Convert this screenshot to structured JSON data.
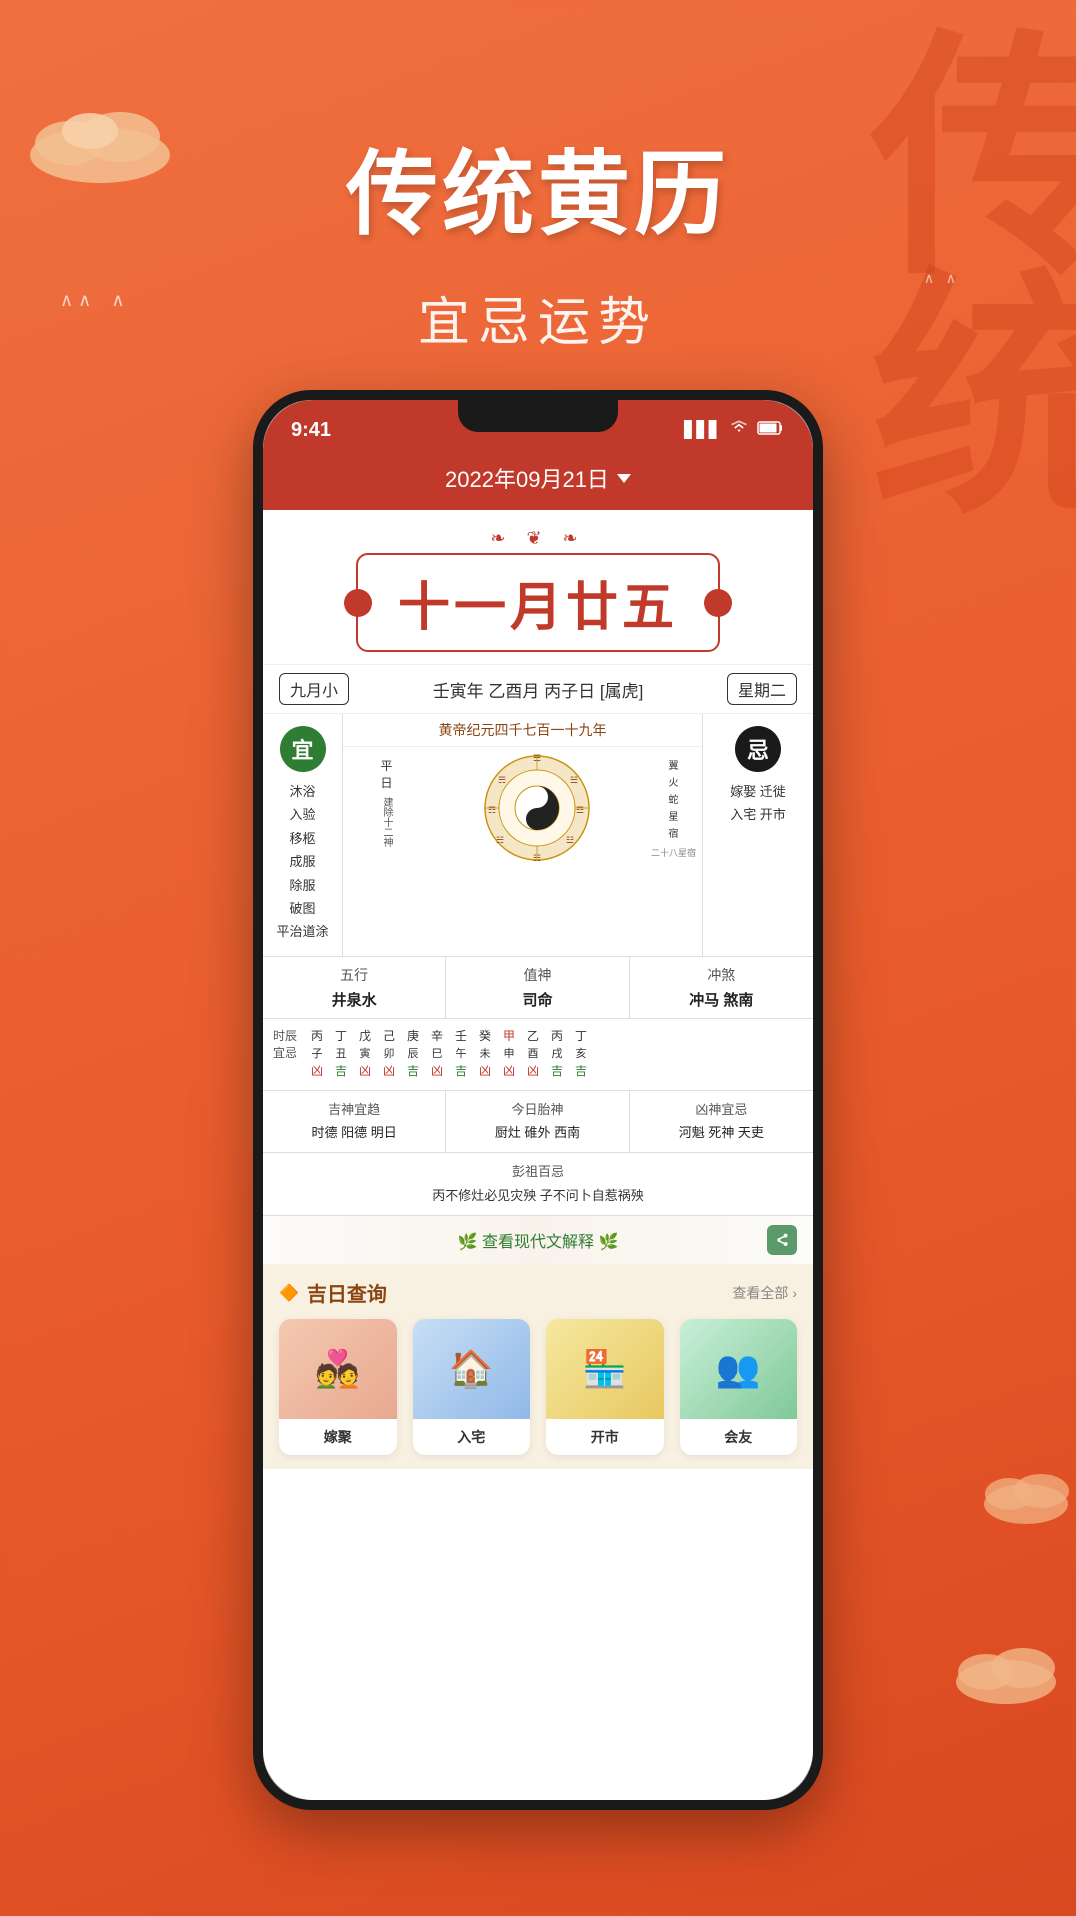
{
  "background": {
    "color": "#e85a30"
  },
  "decorative": {
    "bg_text": "传统",
    "birds": "∨  ∨",
    "birds2": "∨"
  },
  "header": {
    "main_title": "传统黄历",
    "sub_title": "宜忌运势"
  },
  "phone": {
    "status_bar": {
      "time": "9:41",
      "signal": "▋▋▋",
      "wifi": "WiFi",
      "battery": "🔋"
    },
    "date_selector": {
      "label": "2022年09月21日",
      "chevron": "▾"
    },
    "calendar": {
      "deco_top": "❦ ❧",
      "lunar_date": "十一月廿五",
      "month_badge": "九月小",
      "ganzhi": "壬寅年 乙酉月 丙子日 [属虎]",
      "weekday": "星期二",
      "huangdi_year": "黄帝纪元四千七百一十九年",
      "yi_label": "宜",
      "yi_items": [
        "沐浴",
        "入验",
        "移柩",
        "成服",
        "除服",
        "破图",
        "平治道涂"
      ],
      "ji_label": "忌",
      "ji_items": [
        "嫁娶",
        "迁徙",
        "入宅",
        "开市"
      ],
      "jianshen": "建除十二神",
      "pingri": "平日",
      "star1": "翼火蛇星宿",
      "star2": "二十八星宿",
      "five_elements": {
        "label": "五行",
        "value": "井泉水"
      },
      "zhishen": {
        "label": "值神",
        "value": "司命"
      },
      "chong_sha": {
        "label": "冲煞",
        "value": "冲马 煞南"
      },
      "time_stems_label": [
        "时辰",
        "宜忌"
      ],
      "time_stems": [
        {
          "char": "丙",
          "sub": "子",
          "fate": "凶"
        },
        {
          "char": "丁",
          "sub": "丑",
          "fate": "吉"
        },
        {
          "char": "戊",
          "sub": "寅",
          "fate": "凶"
        },
        {
          "char": "己",
          "sub": "卯",
          "fate": "凶"
        },
        {
          "char": "庚",
          "sub": "辰",
          "fate": "吉"
        },
        {
          "char": "辛",
          "sub": "巳",
          "fate": "凶"
        },
        {
          "char": "壬",
          "sub": "午",
          "fate": "吉"
        },
        {
          "char": "癸",
          "sub": "未",
          "fate": "凶"
        },
        {
          "char": "甲",
          "sub": "申",
          "fate": "凶"
        },
        {
          "char": "乙",
          "sub": "酉",
          "fate": "凶"
        },
        {
          "char": "丙",
          "sub": "戌",
          "fate": "吉"
        },
        {
          "char": "丁",
          "sub": "亥",
          "fate": "吉"
        }
      ],
      "ji_shen": {
        "label": "吉神宜趋",
        "value": "时德 阳德 明日"
      },
      "tai_shen": {
        "label": "今日胎神",
        "value": "厨灶 碓外 西南"
      },
      "xiong_shen": {
        "label": "凶神宜忌",
        "value": "河魁 死神 天吏"
      },
      "pengzu_label": "彭祖百忌",
      "pengzu_value": "丙不修灶必见灾殃  子不问卜自惹祸殃",
      "view_modern": "🌿 查看现代文解释 🌿"
    },
    "lucky": {
      "title": "吉日查询",
      "more": "查看全部",
      "items": [
        {
          "label": "嫁聚",
          "emoji": "💑"
        },
        {
          "label": "入宅",
          "emoji": "🏠"
        },
        {
          "label": "开市",
          "emoji": "🏪"
        },
        {
          "label": "会友",
          "emoji": "👥"
        }
      ]
    }
  }
}
